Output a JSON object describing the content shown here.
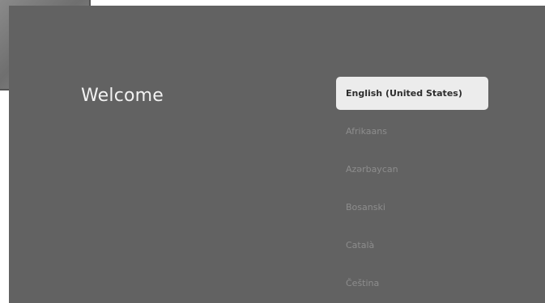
{
  "welcome": {
    "title": "Welcome"
  },
  "languages": {
    "selected_index": 0,
    "items": [
      {
        "label": "English (United States)"
      },
      {
        "label": "Afrikaans"
      },
      {
        "label": "Azərbaycan"
      },
      {
        "label": "Bosanski"
      },
      {
        "label": "Català"
      },
      {
        "label": "Čeština"
      }
    ]
  },
  "colors": {
    "background": "#626262",
    "selected_item": "#ececec",
    "unselected_text": "#8d8d8d",
    "title_text": "#f2f2f2"
  }
}
